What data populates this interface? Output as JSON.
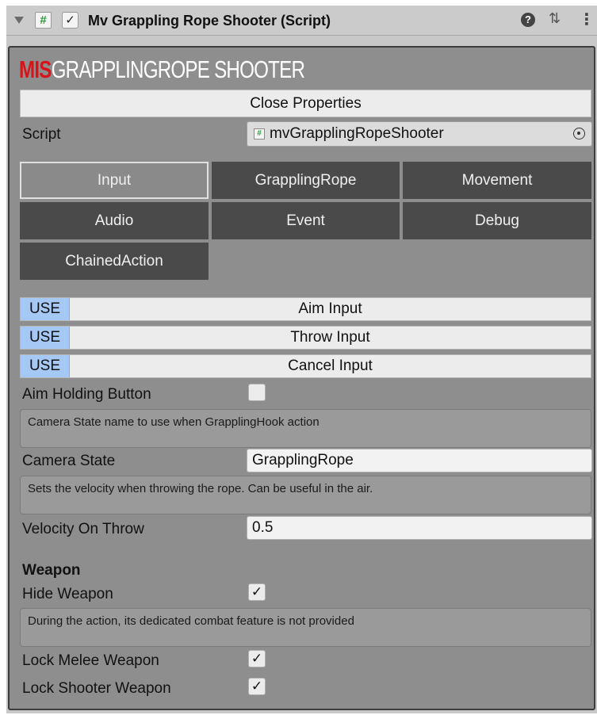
{
  "header": {
    "script_icon": "#",
    "enabled_check": "✓",
    "title": "Mv Grappling Rope Shooter (Script)",
    "help_icon": "?",
    "preset_icon": "⇅",
    "menu_icon": "⋮"
  },
  "logo": {
    "prefix": "MIS",
    "text": "GRAPPLINGROPE SHOOTER",
    "prefix_color": "#d8141a"
  },
  "close_properties_label": "Close Properties",
  "script": {
    "label": "Script",
    "value": "mvGrapplingRopeShooter"
  },
  "tabs": [
    {
      "label": "Input",
      "active": true
    },
    {
      "label": "GrapplingRope",
      "active": false
    },
    {
      "label": "Movement",
      "active": false
    },
    {
      "label": "Audio",
      "active": false
    },
    {
      "label": "Event",
      "active": false
    },
    {
      "label": "Debug",
      "active": false
    },
    {
      "label": "ChainedAction",
      "active": false
    }
  ],
  "inputs": [
    {
      "badge": "USE",
      "label": "Aim Input"
    },
    {
      "badge": "USE",
      "label": "Throw Input"
    },
    {
      "badge": "USE",
      "label": "Cancel Input"
    }
  ],
  "aim_holding": {
    "label": "Aim Holding Button",
    "checked": ""
  },
  "camera_help": "Camera State name to use when GrapplingHook action",
  "camera_state": {
    "label": "Camera State",
    "value": "GrapplingRope"
  },
  "velocity_help": "Sets the velocity when throwing the rope. Can be useful in the air.",
  "velocity_on_throw": {
    "label": "Velocity On Throw",
    "value": "0.5"
  },
  "weapon": {
    "section_title": "Weapon",
    "hide_weapon": {
      "label": "Hide Weapon",
      "checked": "✓"
    },
    "help": "During the action, its dedicated combat feature is not provided",
    "lock_melee": {
      "label": "Lock Melee Weapon",
      "checked": "✓"
    },
    "lock_shooter": {
      "label": "Lock Shooter Weapon",
      "checked": "✓"
    }
  }
}
